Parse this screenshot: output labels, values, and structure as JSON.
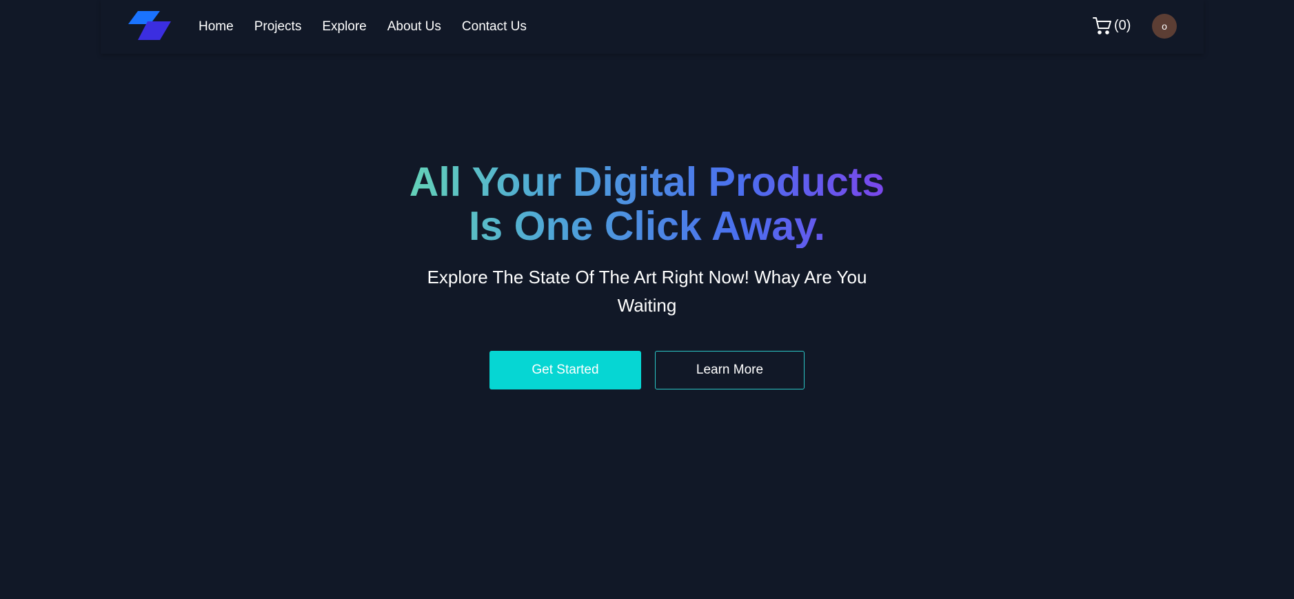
{
  "nav": {
    "links": [
      "Home",
      "Projects",
      "Explore",
      "About Us",
      "Contact Us"
    ],
    "cart_count": "(0)",
    "avatar_initial": "o"
  },
  "hero": {
    "headline_line1": "All Your Digital Products",
    "headline_line2": "Is One Click Away.",
    "subtitle": "Explore The State Of The Art Right Now! Whay Are You Waiting",
    "primary_button": "Get Started",
    "secondary_button": "Learn More"
  },
  "colors": {
    "background": "#111827",
    "accent": "#06d6d3",
    "gradient_start": "#6ee7a8",
    "gradient_end": "#9333ea",
    "avatar_bg": "#5c3e34"
  },
  "icons": {
    "logo": "brand-logo-icon",
    "cart": "shopping-cart-icon"
  }
}
